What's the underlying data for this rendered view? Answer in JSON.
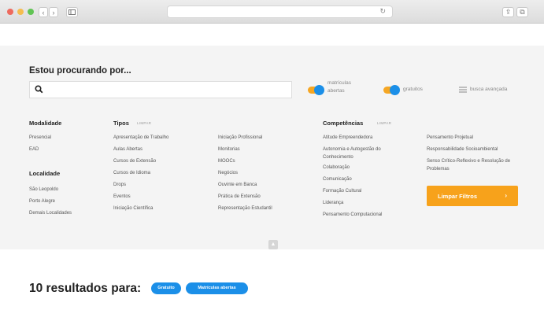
{
  "browser": {
    "url": "",
    "colors": {
      "close": "#ee6a5e",
      "minimize": "#f5bd4f",
      "maximize": "#61c454"
    },
    "icons": [
      "back-icon",
      "forward-icon",
      "sidebar-icon",
      "reload-icon",
      "share-icon",
      "tabs-icon"
    ]
  },
  "search": {
    "heading": "Estou procurando por...",
    "placeholder": "",
    "toggle_matriculas_line1": "matrículas",
    "toggle_matriculas_line2": "abertas",
    "toggle_gratuitos": "gratuitos",
    "advanced": "busca avançada"
  },
  "filters": {
    "modalidade": {
      "title": "Modalidade",
      "items": [
        "Presencial",
        "EAD"
      ]
    },
    "localidade": {
      "title": "Localidade",
      "items": [
        "São Leopoldo",
        "Porto Alegre",
        "Demais Localidades"
      ]
    },
    "tipos": {
      "title": "Tipos",
      "clear": "LIMPAR",
      "col1": [
        "Apresentação de Trabalho",
        "Aulas Abertas",
        "Cursos de Extensão",
        "Cursos de Idioma",
        "Drops",
        "Eventos",
        "Iniciação Científica"
      ],
      "col2": [
        "Iniciação Profissional",
        "Monitorias",
        "MOOCs",
        "Negócios",
        "Ouvinte em Banca",
        "Prática de Extensão",
        "Representação Estudantil"
      ]
    },
    "competencias": {
      "title": "Competências",
      "clear": "LIMPAR",
      "col1": [
        "Atitude Empreendedora",
        "Autonomia e Autogestão do Conhecimento",
        "Colaboração",
        "Comunicação",
        "Formação Cultural",
        "Liderança",
        "Pensamento Computacional"
      ],
      "col2": [
        "Pensamento Projetual",
        "Responsabilidade Socioambiental",
        "Senso Crítico-Reflexivo e Resolução de Problemas"
      ]
    },
    "clear_button": "Limpar Filtros",
    "clear_button_chevron": "›",
    "accent": "#f7a21b",
    "toggle_on": "#1b8fe8"
  },
  "results": {
    "text": "10 resultados para:",
    "chips": [
      "Gratuito",
      "Matrículas abertas"
    ]
  }
}
